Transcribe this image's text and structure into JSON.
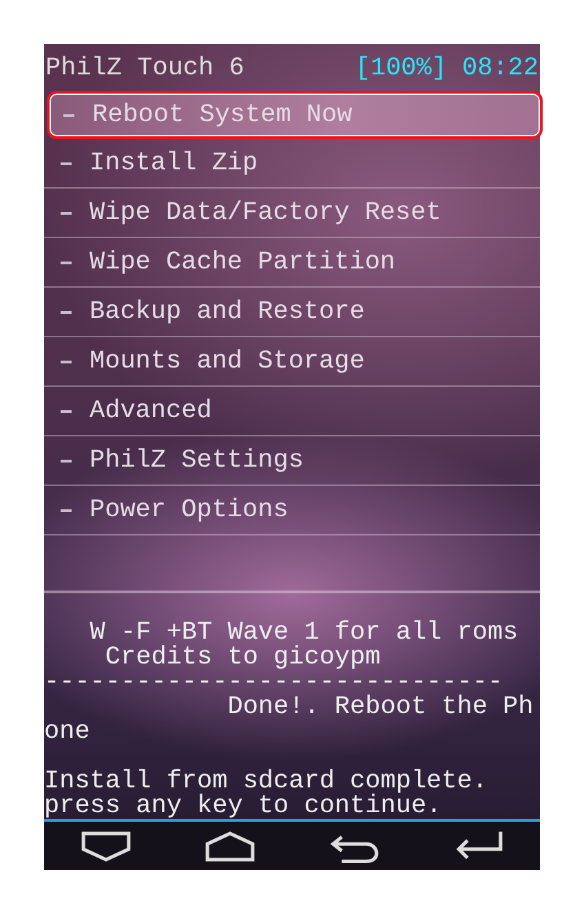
{
  "header": {
    "title": "PhilZ Touch 6",
    "battery": "[100%]",
    "time": "08:22"
  },
  "menu": [
    {
      "label": "Reboot System Now",
      "selected": true
    },
    {
      "label": "Install Zip",
      "selected": false
    },
    {
      "label": "Wipe Data/Factory Reset",
      "selected": false
    },
    {
      "label": "Wipe Cache Partition",
      "selected": false
    },
    {
      "label": "Backup and Restore",
      "selected": false
    },
    {
      "label": "Mounts and Storage",
      "selected": false
    },
    {
      "label": "Advanced",
      "selected": false
    },
    {
      "label": "PhilZ Settings",
      "selected": false
    },
    {
      "label": "Power Options",
      "selected": false
    }
  ],
  "log": [
    {
      "lines": [
        "   W -F +BT Wave 1 for all roms",
        "    Credits to gicoypm",
        "------------------------------",
        "            Done!. Reboot the Ph",
        "one"
      ]
    },
    {
      "lines": [
        "Install from sdcard complete.",
        "press any key to continue."
      ]
    }
  ],
  "nav_bar": [
    {
      "kind": "recent"
    },
    {
      "kind": "home"
    },
    {
      "kind": "back"
    },
    {
      "kind": "enter"
    }
  ]
}
